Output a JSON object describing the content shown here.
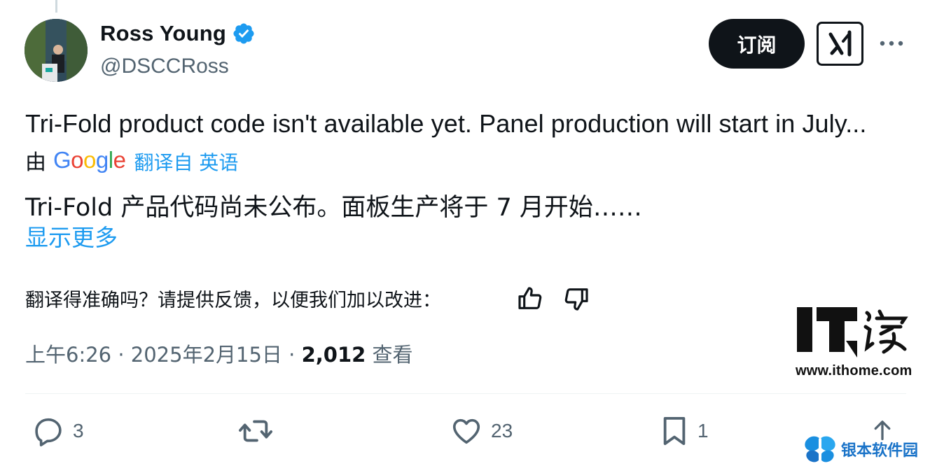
{
  "author": {
    "display_name": "Ross Young",
    "handle": "@DSCCRoss"
  },
  "header_actions": {
    "subscribe_label": "订阅"
  },
  "tweet": {
    "text": "Tri-Fold product code isn't available yet. Panel production will start in July...",
    "translation": {
      "by_label": "由",
      "provider": "Google",
      "from_label": "翻译自 英语",
      "text": "Tri-Fold 产品代码尚未公布。面板生产将于 7 月开始……",
      "show_more": "显示更多",
      "feedback_prompt": "翻译得准确吗？请提供反馈，以便我们加以改进："
    },
    "meta": {
      "time": "上午6:26",
      "separator": "·",
      "date": "2025年2月15日",
      "views_count": "2,012",
      "views_label": "查看"
    }
  },
  "actions": {
    "replies": "3",
    "retweets": "",
    "likes": "23",
    "bookmarks": "1"
  },
  "watermarks": {
    "it_logo_text": "IT之家",
    "it_url": "www.ithome.com",
    "bottom_text": "银本软件园"
  },
  "colors": {
    "accent": "#1d9bf0",
    "secondary_text": "#536471",
    "primary_text": "#0f1419",
    "subscribe_bg": "#0f1419"
  },
  "icons": {
    "verified": "verified-badge-icon",
    "grok": "grok-icon",
    "more": "more-horizontal-icon",
    "thumbs_up": "thumbs-up-icon",
    "thumbs_down": "thumbs-down-icon",
    "reply": "reply-icon",
    "retweet": "retweet-icon",
    "like": "heart-icon",
    "bookmark": "bookmark-icon",
    "share": "share-icon"
  }
}
